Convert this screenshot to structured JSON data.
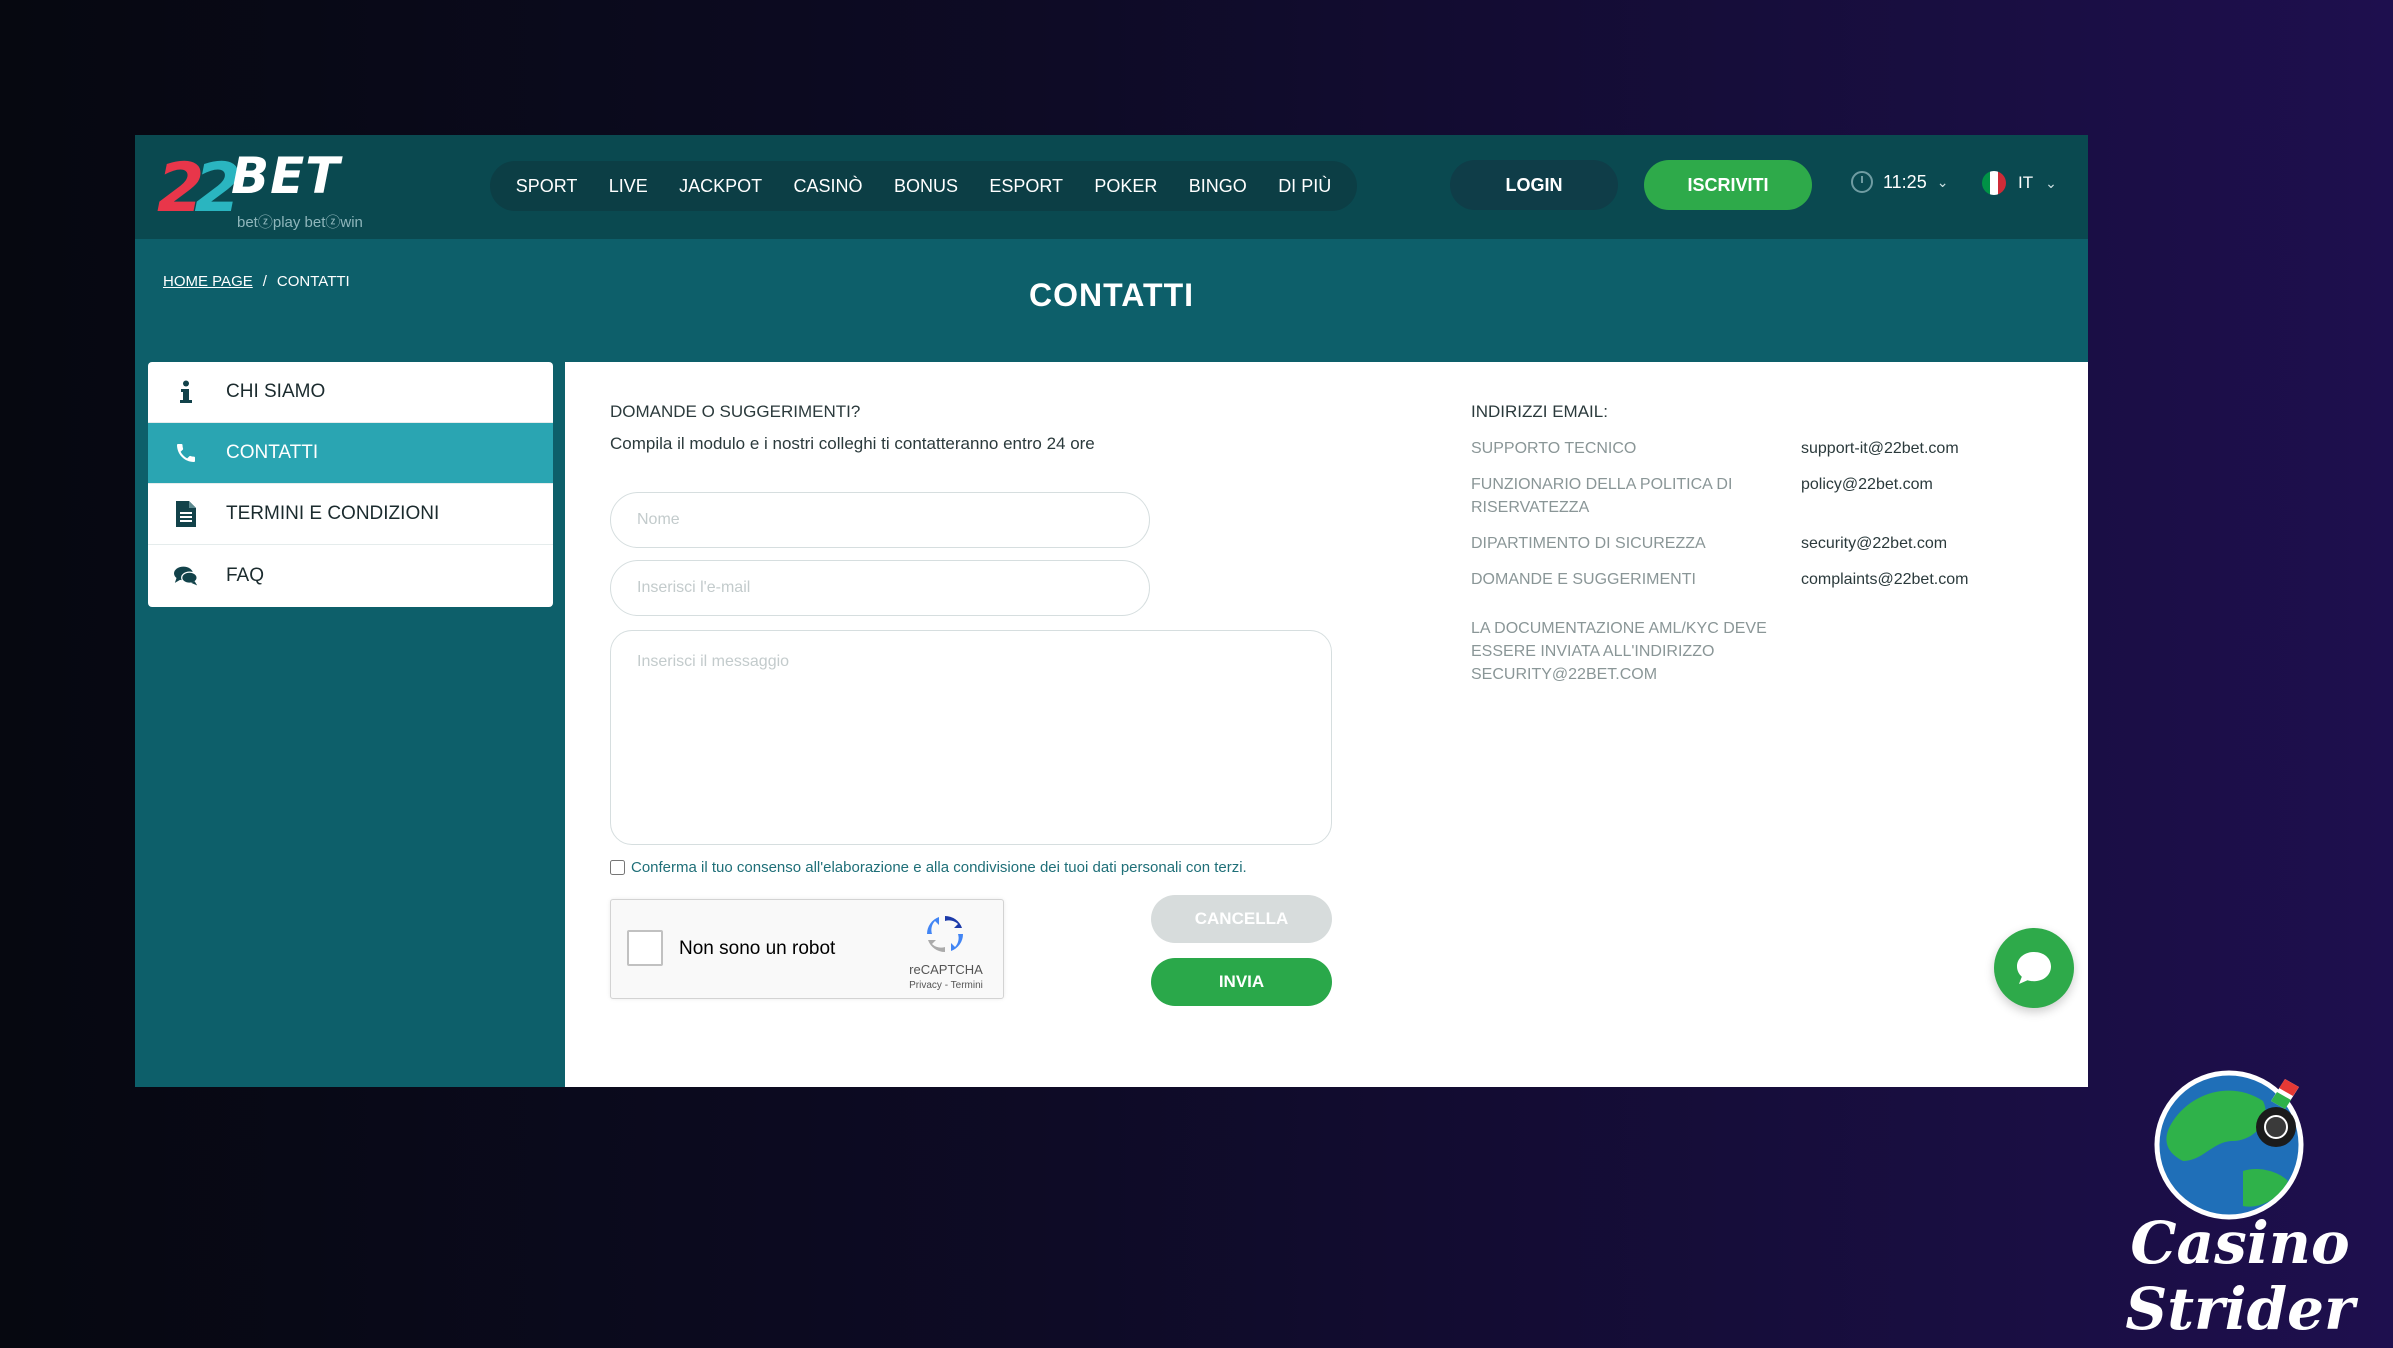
{
  "brand": {
    "logo_digits": "22",
    "logo_word": "BET",
    "tagline": "betⓩplay betⓩwin"
  },
  "nav": [
    "SPORT",
    "LIVE",
    "JACKPOT",
    "CASINÒ",
    "BONUS",
    "ESPORT",
    "POKER",
    "BINGO",
    "DI PIÙ"
  ],
  "header": {
    "login_label": "LOGIN",
    "signup_label": "ISCRIVITI",
    "time": "11:25",
    "lang": "IT",
    "colors": {
      "signup": "#2eaa4a",
      "login": "#0f3d48"
    }
  },
  "breadcrumb": {
    "home": "HOME PAGE",
    "separator": "/",
    "current": "CONTATTI"
  },
  "page_title": "CONTATTI",
  "sidebar": {
    "items": [
      {
        "label": "CHI SIAMO",
        "icon": "info-icon",
        "active": false
      },
      {
        "label": "CONTATTI",
        "icon": "phone-icon",
        "active": true
      },
      {
        "label": "TERMINI E CONDIZIONI",
        "icon": "document-icon",
        "active": false
      },
      {
        "label": "FAQ",
        "icon": "chat-bubbles-icon",
        "active": false
      }
    ]
  },
  "form": {
    "title": "DOMANDE O SUGGERIMENTI?",
    "subtitle": "Compila il modulo e i nostri colleghi ti contatteranno entro 24 ore",
    "name_placeholder": "Nome",
    "email_placeholder": "Inserisci l'e-mail",
    "message_placeholder": "Inserisci il messaggio",
    "consent": "Conferma il tuo consenso all'elaborazione e alla condivisione dei tuoi dati personali con terzi.",
    "captcha_label": "Non sono un robot",
    "captcha_brand": "reCAPTCHA",
    "captcha_links": "Privacy - Termini",
    "cancel_label": "CANCELLA",
    "send_label": "INVIA"
  },
  "emails": {
    "title": "INDIRIZZI EMAIL:",
    "rows": [
      {
        "label": "SUPPORTO TECNICO",
        "value": "support-it@22bet.com"
      },
      {
        "label": "FUNZIONARIO DELLA POLITICA DI RISERVATEZZA",
        "value": "policy@22bet.com"
      },
      {
        "label": "DIPARTIMENTO DI SICUREZZA",
        "value": "security@22bet.com"
      },
      {
        "label": "DOMANDE E SUGGERIMENTI",
        "value": "complaints@22bet.com"
      }
    ],
    "aml_note": "LA DOCUMENTAZIONE AML/KYC DEVE ESSERE INVIATA ALL'INDIRIZZO SECURITY@22BET.COM"
  },
  "watermark": {
    "line1": "Casino",
    "line2": "Strider"
  }
}
